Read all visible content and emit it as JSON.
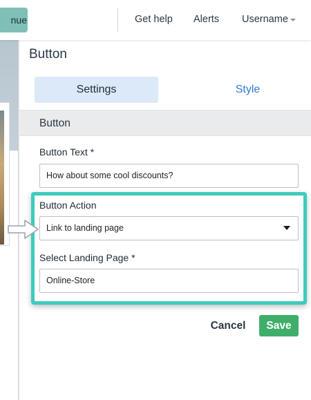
{
  "topbar": {
    "continue_label": "nue",
    "help_label": "Get help",
    "alerts_label": "Alerts",
    "user_label": "Username"
  },
  "panel": {
    "title": "Button",
    "tabs": [
      {
        "label": "Settings",
        "active": true
      },
      {
        "label": "Style",
        "active": false
      }
    ],
    "section_title": "Button"
  },
  "form": {
    "button_text": {
      "label": "Button Text *",
      "value": "How about some cool discounts?"
    },
    "button_action": {
      "label": "Button Action",
      "selected": "Link to landing page"
    },
    "landing_page": {
      "label": "Select Landing Page *",
      "value": "Online-Store"
    }
  },
  "actions": {
    "cancel_label": "Cancel",
    "save_label": "Save"
  },
  "colors": {
    "accent": "#3ecbbd",
    "save": "#3fae6b",
    "tab_active_bg": "#dbe9f9",
    "link": "#2e7bd6",
    "continue_bg": "#7fbfb6"
  },
  "icons": [
    "chevron-down-icon",
    "dropdown-caret-icon",
    "pointer-arrow-icon"
  ]
}
